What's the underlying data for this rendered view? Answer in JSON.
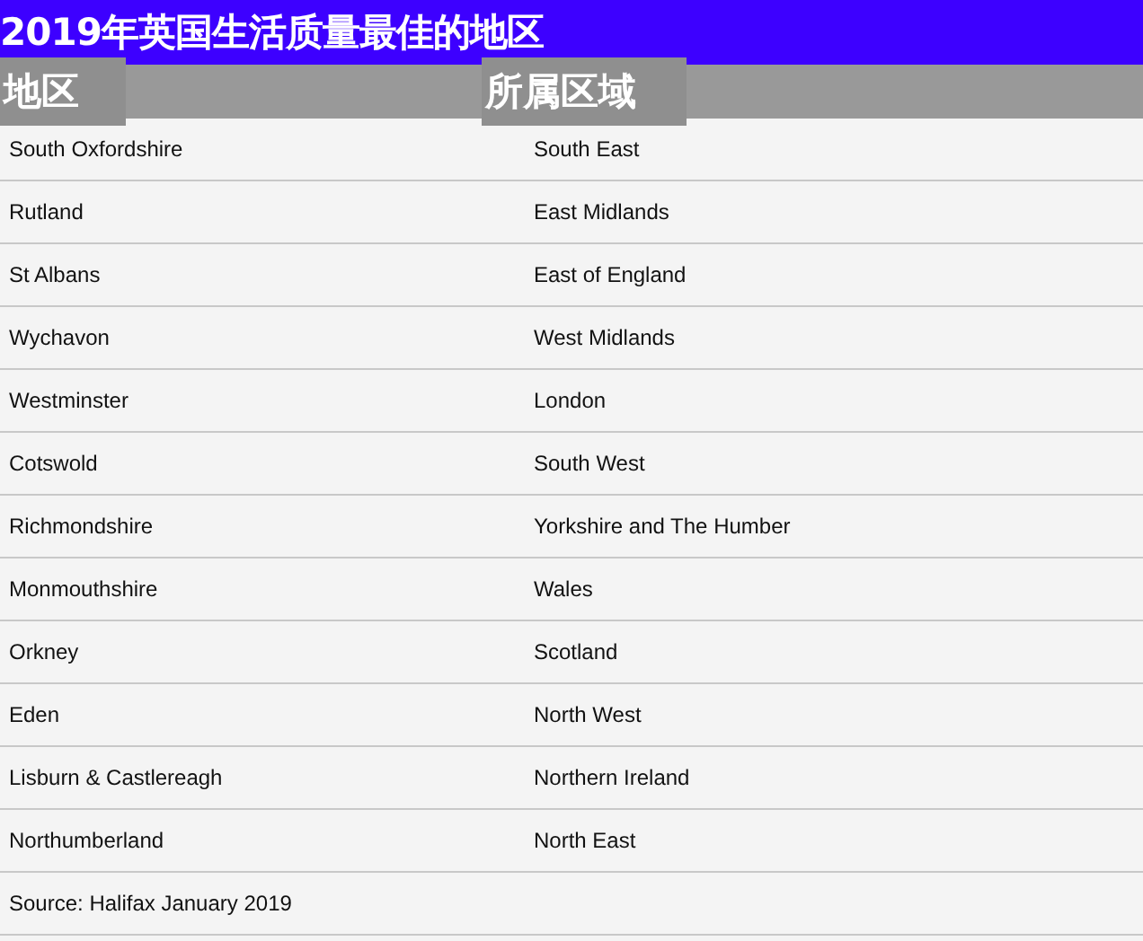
{
  "title": "2019年英国生活质量最佳的地区",
  "table": {
    "columns": [
      "地区",
      "所属区域"
    ],
    "rows": [
      [
        "South Oxfordshire",
        "South East"
      ],
      [
        "Rutland",
        "East Midlands"
      ],
      [
        "St Albans",
        "East of England"
      ],
      [
        "Wychavon",
        "West Midlands"
      ],
      [
        "Westminster",
        "London"
      ],
      [
        "Cotswold",
        "South West"
      ],
      [
        "Richmondshire",
        "Yorkshire and The Humber"
      ],
      [
        "Monmouthshire",
        "Wales"
      ],
      [
        "Orkney",
        "Scotland"
      ],
      [
        "Eden",
        "North West"
      ],
      [
        "Lisburn & Castlereagh",
        "Northern Ireland"
      ],
      [
        "Northumberland",
        "North East"
      ]
    ]
  },
  "source": "Source: Halifax January 2019"
}
